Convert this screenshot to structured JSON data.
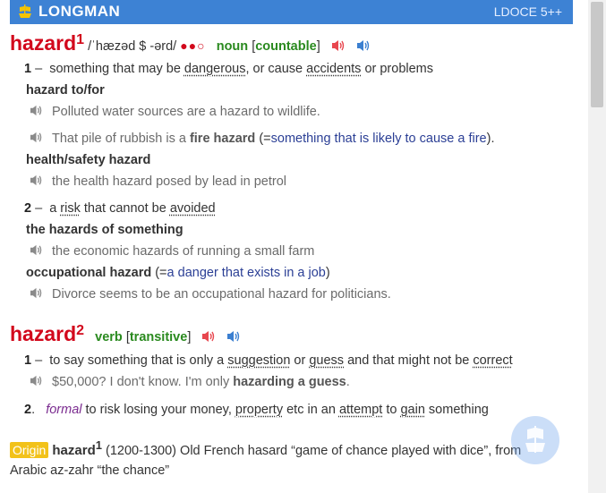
{
  "header": {
    "brand": "LONGMAN",
    "edition": "LDOCE 5++"
  },
  "entry1": {
    "headword": "hazard",
    "homnum": "1",
    "pron": "/ˈhæzəd $ -ərd/",
    "freq": "●●○",
    "pos": "noun",
    "gram_open": "[",
    "gram": "countable",
    "gram_close": "]",
    "senses": [
      {
        "num": "1",
        "dash": "–",
        "def": [
          {
            "t": "something that may be "
          },
          {
            "t": "dangerous",
            "u": true
          },
          {
            "t": ", or cause "
          },
          {
            "t": "accidents",
            "u": true
          },
          {
            "t": " or problems"
          }
        ],
        "collocations": [
          {
            "label": "hazard to/for",
            "examples": [
              "Polluted water sources are a hazard to wildlife."
            ]
          }
        ],
        "examples": [
          {
            "pre": "That pile of rubbish is a ",
            "bold": "fire hazard",
            "mid": " (=",
            "gloss": "something that is likely to cause a fire",
            "post": ")."
          }
        ],
        "collocations2": [
          {
            "label": "health/safety hazard",
            "examples": [
              "the health hazard posed by lead in petrol"
            ]
          }
        ]
      },
      {
        "num": "2",
        "dash": "–",
        "def": [
          {
            "t": "a "
          },
          {
            "t": "risk",
            "u": true
          },
          {
            "t": " that cannot be "
          },
          {
            "t": "avoided",
            "u": true
          }
        ],
        "collocations": [
          {
            "label": "the hazards of something",
            "examples": [
              "the economic hazards of running a small farm"
            ]
          },
          {
            "label": "occupational hazard",
            "gloss_open": " (=",
            "gloss": "a danger that exists in a job",
            "gloss_close": ")",
            "examples": [
              "Divorce seems to be an occupational hazard for politicians."
            ]
          }
        ]
      }
    ]
  },
  "entry2": {
    "headword": "hazard",
    "homnum": "2",
    "pos": "verb",
    "gram_open": "[",
    "gram": "transitive",
    "gram_close": "]",
    "senses": [
      {
        "num": "1",
        "dash": "–",
        "def": [
          {
            "t": "to say something that is only a "
          },
          {
            "t": "suggestion",
            "u": true
          },
          {
            "t": " or "
          },
          {
            "t": "guess",
            "u": true
          },
          {
            "t": " and that might not be "
          },
          {
            "t": "correct",
            "u": true
          }
        ],
        "example": {
          "pre": "$50,000? I don't know. I'm only ",
          "bold": "hazarding a guess",
          "post": "."
        }
      },
      {
        "num": "2",
        "dot": ".",
        "register": "formal",
        "def": [
          {
            "t": " to risk losing your money, "
          },
          {
            "t": "property",
            "u": true
          },
          {
            "t": " etc in an "
          },
          {
            "t": "attempt",
            "u": true
          },
          {
            "t": " to "
          },
          {
            "t": "gain",
            "u": true
          },
          {
            "t": " something"
          }
        ]
      }
    ]
  },
  "origin": {
    "badge": "Origin",
    "headword": "hazard",
    "homnum": "1",
    "text1": " (1200-1300) Old French hasard “game of chance played with dice”, from",
    "text2": "Arabic az-zahr “the chance”"
  },
  "colors": {
    "header": "#3d82d4",
    "headword": "#d2081c",
    "pos": "#2a8a1f",
    "gloss": "#2b3f95",
    "origin_badge": "#f2c21a"
  },
  "icons": [
    "longman-ship-icon",
    "speaker-british-icon",
    "speaker-american-icon",
    "speaker-example-icon",
    "floating-app-icon"
  ]
}
